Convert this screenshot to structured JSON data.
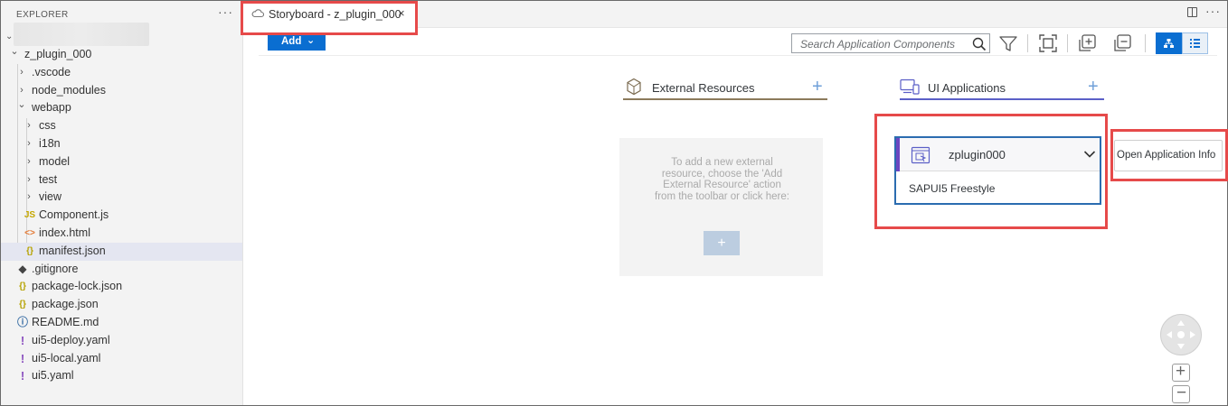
{
  "explorer": {
    "title": "EXPLORER",
    "more": "···",
    "items": [
      {
        "label": "z_plugin_000",
        "kind": "folder-open",
        "depth": 0
      },
      {
        "label": ".vscode",
        "kind": "folder",
        "depth": 1
      },
      {
        "label": "node_modules",
        "kind": "folder",
        "depth": 1
      },
      {
        "label": "webapp",
        "kind": "folder-open",
        "depth": 1
      },
      {
        "label": "css",
        "kind": "folder",
        "depth": 2
      },
      {
        "label": "i18n",
        "kind": "folder",
        "depth": 2
      },
      {
        "label": "model",
        "kind": "folder",
        "depth": 2
      },
      {
        "label": "test",
        "kind": "folder",
        "depth": 2
      },
      {
        "label": "view",
        "kind": "folder",
        "depth": 2
      },
      {
        "label": "Component.js",
        "kind": "js",
        "depth": 2
      },
      {
        "label": "index.html",
        "kind": "html",
        "depth": 2
      },
      {
        "label": "manifest.json",
        "kind": "json",
        "depth": 2,
        "selected": true
      },
      {
        "label": ".gitignore",
        "kind": "git",
        "depth": 1
      },
      {
        "label": "package-lock.json",
        "kind": "json",
        "depth": 1
      },
      {
        "label": "package.json",
        "kind": "json",
        "depth": 1
      },
      {
        "label": "README.md",
        "kind": "info",
        "depth": 1
      },
      {
        "label": "ui5-deploy.yaml",
        "kind": "yaml",
        "depth": 1
      },
      {
        "label": "ui5-local.yaml",
        "kind": "yaml",
        "depth": 1
      },
      {
        "label": "ui5.yaml",
        "kind": "yaml",
        "depth": 1
      }
    ]
  },
  "tabs": {
    "active_label": "Storyboard - z_plugin_000",
    "close": "×",
    "more": "···"
  },
  "toolbar": {
    "add_label": "Add",
    "add_caret": "⌄",
    "search_placeholder": "Search Application Components"
  },
  "columns": {
    "external": {
      "title": "External Resources",
      "add": "+",
      "empty_text": "To add a new external resource, choose the 'Add External Resource' action from the toolbar or click here:",
      "empty_add": "+"
    },
    "ui_apps": {
      "title": "UI Applications",
      "add": "+"
    }
  },
  "app_card": {
    "name": "zplugin000",
    "type": "SAPUI5 Freestyle"
  },
  "info_button": {
    "label": "Open Application Info"
  },
  "zoom": {
    "in": "+",
    "out": "−"
  },
  "colors": {
    "accent_blue": "#0a6ed1",
    "highlight_red": "#e64a4a",
    "external_underline": "#8c7a5b",
    "ui_underline": "#5b5fc7",
    "app_accent": "#6b46c1"
  }
}
